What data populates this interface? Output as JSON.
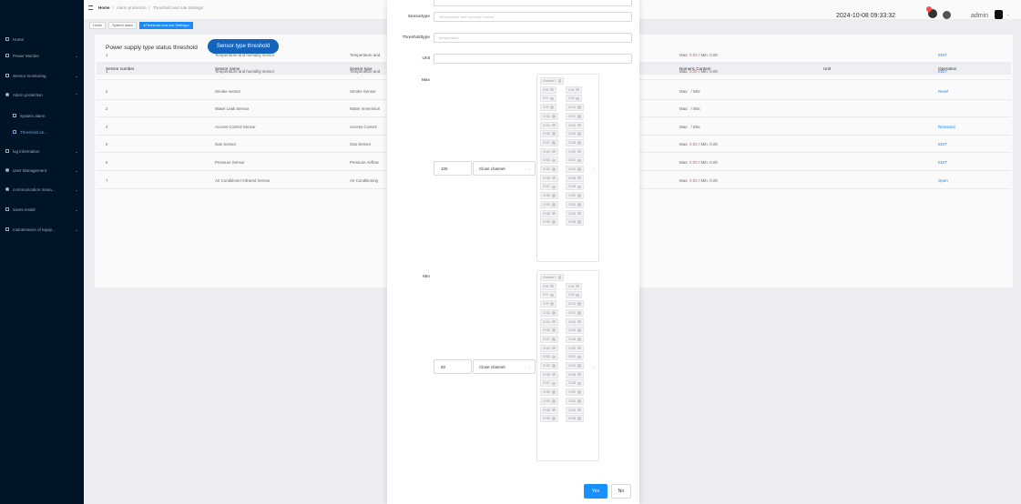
{
  "sidebar": {
    "items": [
      {
        "label": "Home",
        "icon": "home-icon",
        "name": "sidebar-item-home"
      },
      {
        "label": "Power Monitor",
        "icon": "monitor-icon",
        "name": "sidebar-item-power-monitor"
      },
      {
        "label": "Sensor monitoring",
        "icon": "sensor-icon",
        "name": "sidebar-item-sensor-monitoring"
      },
      {
        "label": "Alarm protection",
        "icon": "alarm-icon",
        "name": "sidebar-item-alarm-protection"
      },
      {
        "label": "System alarm",
        "icon": "list-icon",
        "name": "sidebar-item-system-alarm"
      },
      {
        "label": "Threshold an...",
        "icon": "threshold-icon",
        "name": "sidebar-item-threshold"
      },
      {
        "label": "log information",
        "icon": "log-icon",
        "name": "sidebar-item-log"
      },
      {
        "label": "User Management",
        "icon": "user-icon",
        "name": "sidebar-item-user-management"
      },
      {
        "label": "communication mana...",
        "icon": "communication-icon",
        "name": "sidebar-item-communication"
      },
      {
        "label": "saves install",
        "icon": "save-icon",
        "name": "sidebar-item-saves-install"
      },
      {
        "label": "maintenance of equip...",
        "icon": "maintenance-icon",
        "name": "sidebar-item-maintenance"
      }
    ]
  },
  "header": {
    "breadcrumb": [
      "Home",
      "Alarm protection",
      "Threshold and rule Settings"
    ],
    "tabs": [
      "Home",
      "System alarm",
      "Threshold and rule Settings"
    ],
    "datetime": "2024-10-08 09:33:32",
    "user": "admin"
  },
  "main": {
    "title": "Power supply type status threshold",
    "type_button": "Sensor type threshold",
    "columns": [
      "Sensor number",
      "Sensor name",
      "Sensor type",
      "Numeric Content",
      "Unit",
      "Operation"
    ],
    "rows": [
      {
        "num": "1",
        "name": "Temperature and humidity sensor",
        "type": "Temperature and",
        "max": "0.00",
        "min": "0.00",
        "op": "EDIT"
      },
      {
        "num": "1",
        "name": "Temperature and humidity sensor",
        "type": "Temperature and",
        "max": "0.00",
        "min": "0.00",
        "op": "EDIT"
      },
      {
        "num": "2",
        "name": "Smoke sensor",
        "type": "Smoke Sensor",
        "max": "",
        "min": "",
        "op": "Reset"
      },
      {
        "num": "2",
        "name": "Water Leak Sensor",
        "type": "Water Immersion",
        "max": "",
        "min": "",
        "op": ""
      },
      {
        "num": "4",
        "name": "Access Control Sensor",
        "type": "Access Control",
        "max": "",
        "min": "",
        "op": "Released"
      },
      {
        "num": "5",
        "name": "Gas Sensor",
        "type": "Gas Sensor",
        "max": "0.00",
        "min": "0.00",
        "op": "EDIT"
      },
      {
        "num": "6",
        "name": "Pressure Sensor",
        "type": "Pressure Airflow",
        "max": "0.00",
        "min": "0.00",
        "op": "EDIT"
      },
      {
        "num": "7",
        "name": "Air Conditioner Infrared Sensor",
        "type": "Air Conditioning",
        "max": "0.00",
        "min": "0.00",
        "op": "Open"
      }
    ],
    "max_prefix": "Max:",
    "min_prefix": "/ Min:"
  },
  "modal": {
    "sensortype_label": "Sensortype",
    "sensortype_value": "Temperature and Humidity Sensor",
    "thresholdtype_label": "Thresholdtype",
    "thresholdtype_value": "temperature",
    "unit_label": "Unit",
    "unit_value": "",
    "max_label": "Max",
    "max_value": "100",
    "max_select": "Close channel",
    "min_label": "Min",
    "min_value": "50",
    "min_select": "Close channel",
    "channels": [
      "Channel 1",
      "CH5",
      "CH6",
      "CH7",
      "CH8",
      "CH9",
      "CH10",
      "CH11",
      "CH12",
      "CH13",
      "CH14",
      "CH15",
      "CH16",
      "CH17",
      "CH18",
      "CH19",
      "CH20",
      "CH21",
      "CH22",
      "CH23",
      "CH24",
      "CH25",
      "CH26",
      "CH27",
      "CH28",
      "CH29",
      "CH30",
      "CH31",
      "CH32",
      "CH33",
      "CH34",
      "CH35",
      "CH36"
    ],
    "yes_button": "Yes",
    "no_button": "No"
  },
  "colors": {
    "accent": "#1890ff",
    "sidebar_bg": "#001529",
    "alert": "#ff4d4f"
  }
}
